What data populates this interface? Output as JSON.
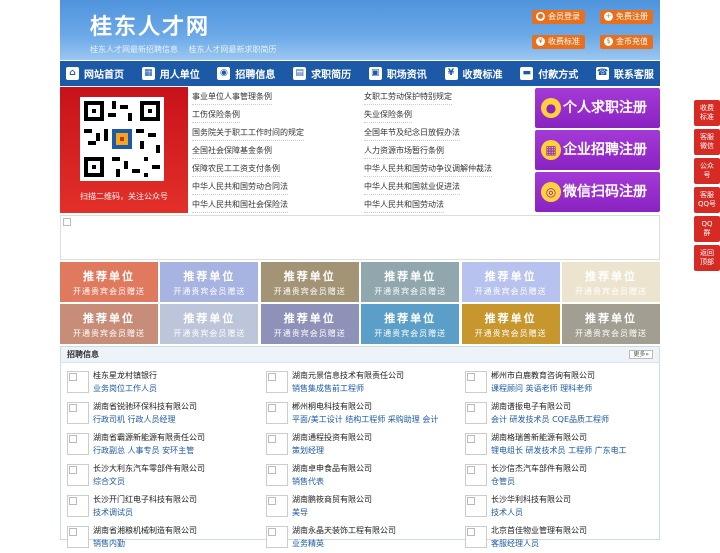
{
  "header": {
    "title": "桂东人才网",
    "subtitle_1": "桂东人才网最新招聘信息",
    "subtitle_2": "桂东人才网最新求职简历",
    "buttons": [
      "会员登录",
      "免费注册",
      "收费标准",
      "金币充值"
    ]
  },
  "nav": [
    "网站首页",
    "用人单位",
    "招聘信息",
    "求职简历",
    "职场资讯",
    "收费标准",
    "付款方式",
    "联系客服"
  ],
  "qr_caption": "扫描二维码，关注公众号",
  "links": [
    [
      "事业单位人事管理条例",
      "女职工劳动保护特别规定"
    ],
    [
      "工伤保险条例",
      "失业保险条例"
    ],
    [
      "国务院关于职工工作时间的规定",
      "全国年节及纪念日放假办法"
    ],
    [
      "全国社会保障基金条例",
      "人力资源市场暂行条例"
    ],
    [
      "保障农民工工资支付条例",
      "中华人民共和国劳动争议调解仲裁法"
    ],
    [
      "中华人民共和国劳动合同法",
      "中华人民共和国就业促进法"
    ],
    [
      "中华人民共和国社会保险法",
      "中华人民共和国劳动法"
    ]
  ],
  "register": [
    "个人求职注册",
    "企业招聘注册",
    "微信扫码注册"
  ],
  "tiles": {
    "title": "推荐单位",
    "sub": "开通贵宾会员赠送",
    "colors": [
      "#5f9aa6",
      "#e07a5f",
      "#a7b3e0",
      "#a39476",
      "#8fa7ad",
      "#b7c2ee",
      "#ede4d0",
      "#c78d79",
      "#bcc5d9",
      "#8e91b8",
      "#5b9fc9",
      "#c7962d",
      "#a29e92"
    ]
  },
  "jobs": {
    "title": "招聘信息",
    "more": "更多»",
    "items": [
      {
        "company": "桂东星龙村镇银行",
        "positions": "业务岗位工作人员"
      },
      {
        "company": "湖南元景信息技术有限责任公司",
        "positions": "销售集成售前工程师"
      },
      {
        "company": "郴州市白鹿教育咨询有限公司",
        "positions": "课程顾问 英语老师 理科老师"
      },
      {
        "company": "湖南省锐驰环保科技有限公司",
        "positions": "行政司机 行政人员经理"
      },
      {
        "company": "郴州桐电科技有限公司",
        "positions": "平面/美工设计 结构工程师 采购助理 会计"
      },
      {
        "company": "湖南谱振电子有限公司",
        "positions": "会计 研发技术员 CQE品质工程师"
      },
      {
        "company": "湖南省霸源新能源有限责任公司",
        "positions": "行政副总 人事专员 安环主管"
      },
      {
        "company": "湖南通程投资有限公司",
        "positions": "策划经理"
      },
      {
        "company": "湖南格瑞普新能源有限公司",
        "positions": "锂电组长 研发技术员 工程师 广东电工"
      },
      {
        "company": "长沙大利东汽车零部件有限公司",
        "positions": "综合文员"
      },
      {
        "company": "湖南卓申食品有限公司",
        "positions": "销售代表"
      },
      {
        "company": "长沙信杰汽车部件有限公司",
        "positions": "仓管员"
      },
      {
        "company": "长沙开门红电子科技有限公司",
        "positions": "技术调试员"
      },
      {
        "company": "湖南鹏筱商贸有限公司",
        "positions": "美导"
      },
      {
        "company": "长沙华利科技有限公司",
        "positions": "技术人员"
      },
      {
        "company": "湖南省湘粮机械制造有限公司",
        "positions": "销售内勤"
      },
      {
        "company": "湖南永晶天装饰工程有限公司",
        "positions": "业务精英"
      },
      {
        "company": "北京首佳物业管理有限公司",
        "positions": "客服经理人员"
      }
    ]
  },
  "side_buttons": [
    "收费标准",
    "客服微信",
    "公众号",
    "客服QQ号",
    "QQ群",
    "返回顶部"
  ]
}
